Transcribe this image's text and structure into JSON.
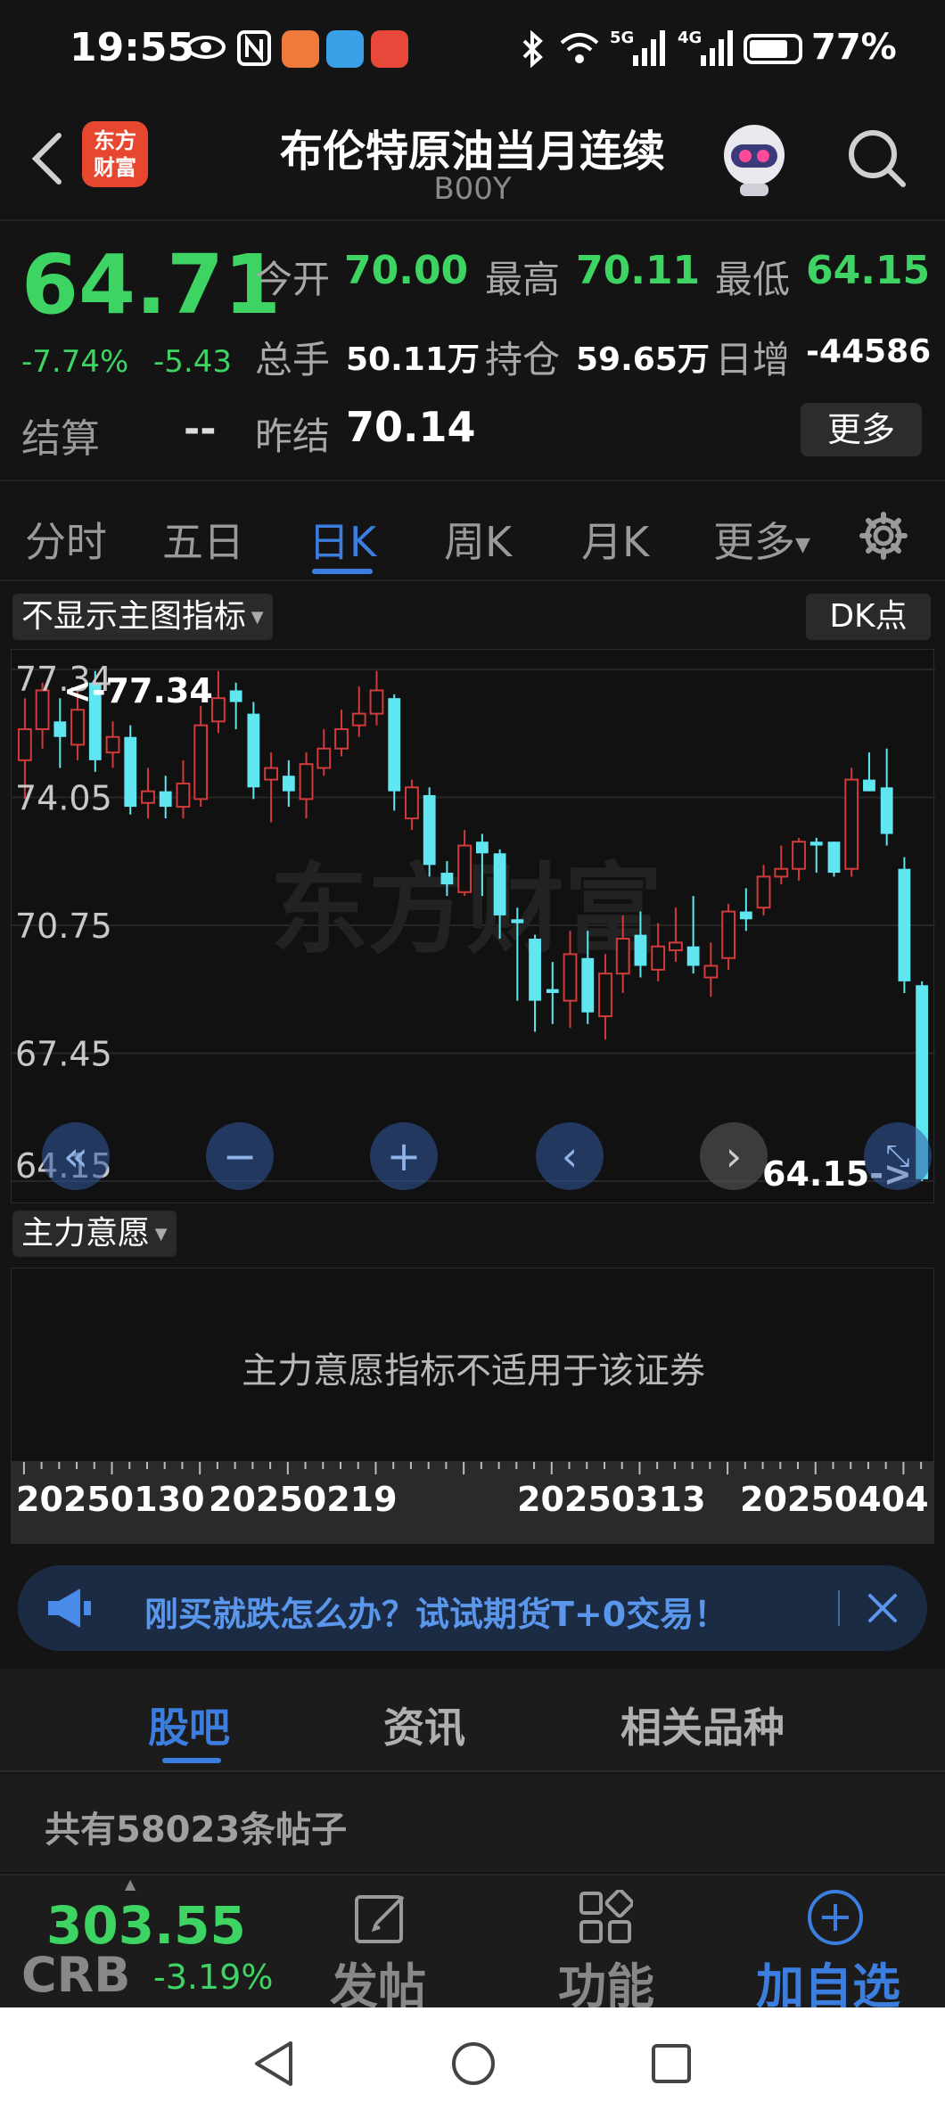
{
  "status_bar": {
    "time": "19:55",
    "battery": "77%",
    "icons": [
      "eye-icon",
      "nfc-icon",
      "app-icon-1",
      "weather-icon",
      "app-icon-3",
      "bluetooth-icon",
      "wifi-icon",
      "5g-signal-icon",
      "4g-signal-icon",
      "battery-icon"
    ],
    "signal_5g": "5G",
    "signal_4g": "4G"
  },
  "header": {
    "title": "布伦特原油当月连续",
    "code": "B00Y",
    "app_logo": "东方财富"
  },
  "quote": {
    "price": "64.71",
    "change_pct": "-7.74%",
    "change": "-5.43",
    "open_label": "今开",
    "open": "70.00",
    "high_label": "最高",
    "high": "70.11",
    "low_label": "最低",
    "low": "64.15",
    "volume_label": "总手",
    "volume": "50.11万",
    "oi_label": "持仓",
    "oi": "59.65万",
    "daily_inc_label": "日增",
    "daily_inc": "-44586",
    "settle_label": "结算",
    "settle": "--",
    "prev_settle_label": "昨结",
    "prev_settle": "70.14",
    "more_label": "更多"
  },
  "tabs": {
    "items": [
      "分时",
      "五日",
      "日K",
      "周K",
      "月K",
      "更多"
    ],
    "active": "日K"
  },
  "chart": {
    "indicator_select": "不显示主图指标",
    "dk_label": "DK点",
    "y_labels": [
      "77.34",
      "74.05",
      "70.75",
      "67.45",
      "64.15"
    ],
    "max_marker": "<-77.34",
    "min_marker": "64.15->",
    "watermark": "东方财富",
    "up_color": "#d23b3b",
    "down_color": "#5fe6f0"
  },
  "chart_data": {
    "type": "candlestick",
    "ylim": [
      64.15,
      77.34
    ],
    "x_ticks": [
      "20250130",
      "20250219",
      "20250313",
      "20250404"
    ],
    "candles": [
      [
        75.0,
        75.8,
        76.6,
        74.0
      ],
      [
        75.8,
        76.8,
        77.0,
        75.3
      ],
      [
        76.0,
        75.6,
        76.6,
        74.8
      ],
      [
        75.4,
        76.3,
        76.9,
        75.0
      ],
      [
        77.0,
        75.0,
        77.3,
        74.7
      ],
      [
        75.2,
        75.6,
        76.0,
        74.8
      ],
      [
        75.6,
        73.8,
        75.9,
        73.6
      ],
      [
        73.9,
        74.2,
        74.8,
        73.5
      ],
      [
        74.2,
        73.8,
        74.6,
        73.5
      ],
      [
        73.8,
        74.4,
        75.0,
        73.5
      ],
      [
        74.0,
        75.9,
        76.4,
        73.8
      ],
      [
        76.0,
        76.6,
        77.3,
        75.7
      ],
      [
        76.8,
        76.5,
        77.0,
        75.8
      ],
      [
        76.2,
        74.3,
        76.5,
        74.0
      ],
      [
        74.5,
        74.8,
        75.2,
        73.4
      ],
      [
        74.6,
        74.2,
        75.0,
        73.8
      ],
      [
        74.0,
        74.9,
        75.2,
        73.5
      ],
      [
        74.8,
        75.3,
        75.8,
        74.6
      ],
      [
        75.3,
        75.8,
        76.3,
        75.1
      ],
      [
        75.9,
        76.2,
        76.9,
        75.6
      ],
      [
        76.2,
        76.8,
        77.3,
        75.9
      ],
      [
        76.6,
        74.2,
        76.7,
        73.7
      ],
      [
        73.5,
        74.3,
        74.5,
        73.2
      ],
      [
        74.1,
        72.3,
        74.3,
        72.0
      ],
      [
        72.1,
        71.8,
        72.4,
        71.5
      ],
      [
        71.6,
        72.8,
        73.2,
        71.5
      ],
      [
        72.9,
        72.6,
        73.1,
        71.5
      ],
      [
        72.6,
        71.0,
        72.7,
        70.4
      ],
      [
        70.9,
        70.8,
        71.2,
        68.8
      ],
      [
        70.4,
        68.8,
        70.5,
        68.0
      ],
      [
        69.1,
        69.0,
        69.8,
        68.2
      ],
      [
        68.8,
        70.0,
        70.6,
        68.1
      ],
      [
        69.9,
        68.5,
        70.6,
        68.2
      ],
      [
        68.4,
        69.5,
        70.0,
        67.8
      ],
      [
        69.5,
        70.4,
        71.0,
        69.0
      ],
      [
        70.5,
        69.7,
        71.1,
        69.4
      ],
      [
        69.6,
        70.2,
        70.8,
        69.3
      ],
      [
        70.1,
        70.3,
        71.2,
        69.8
      ],
      [
        70.2,
        69.7,
        71.5,
        69.5
      ],
      [
        69.4,
        69.7,
        70.3,
        68.9
      ],
      [
        69.9,
        71.1,
        71.3,
        69.6
      ],
      [
        71.1,
        70.9,
        71.7,
        70.6
      ],
      [
        71.2,
        72.0,
        72.3,
        71.0
      ],
      [
        72.0,
        72.2,
        72.8,
        71.8
      ],
      [
        72.2,
        72.9,
        73.0,
        71.9
      ],
      [
        72.9,
        72.8,
        73.0,
        72.1
      ],
      [
        72.9,
        72.1,
        72.9,
        72.0
      ],
      [
        72.2,
        74.5,
        74.8,
        72.0
      ],
      [
        74.5,
        74.2,
        75.2,
        74.2
      ],
      [
        74.3,
        73.1,
        75.3,
        72.8
      ],
      [
        72.2,
        69.3,
        72.5,
        69.0
      ],
      [
        69.2,
        64.2,
        69.3,
        64.15
      ]
    ]
  },
  "indicator": {
    "select": "主力意愿",
    "message": "主力意愿指标不适用于该证券"
  },
  "banner": {
    "text": "刚买就跌怎么办？试试期货T+0交易！"
  },
  "sub_tabs": {
    "items": [
      "股吧",
      "资讯",
      "相关品种"
    ],
    "active": "股吧"
  },
  "posts": {
    "count_text": "共有58023条帖子"
  },
  "bottom_bar": {
    "index_value": "303.55",
    "index_name": "CRB",
    "index_change": "-3.19%",
    "post_label": "发帖",
    "function_label": "功能",
    "add_fav_label": "加自选"
  }
}
